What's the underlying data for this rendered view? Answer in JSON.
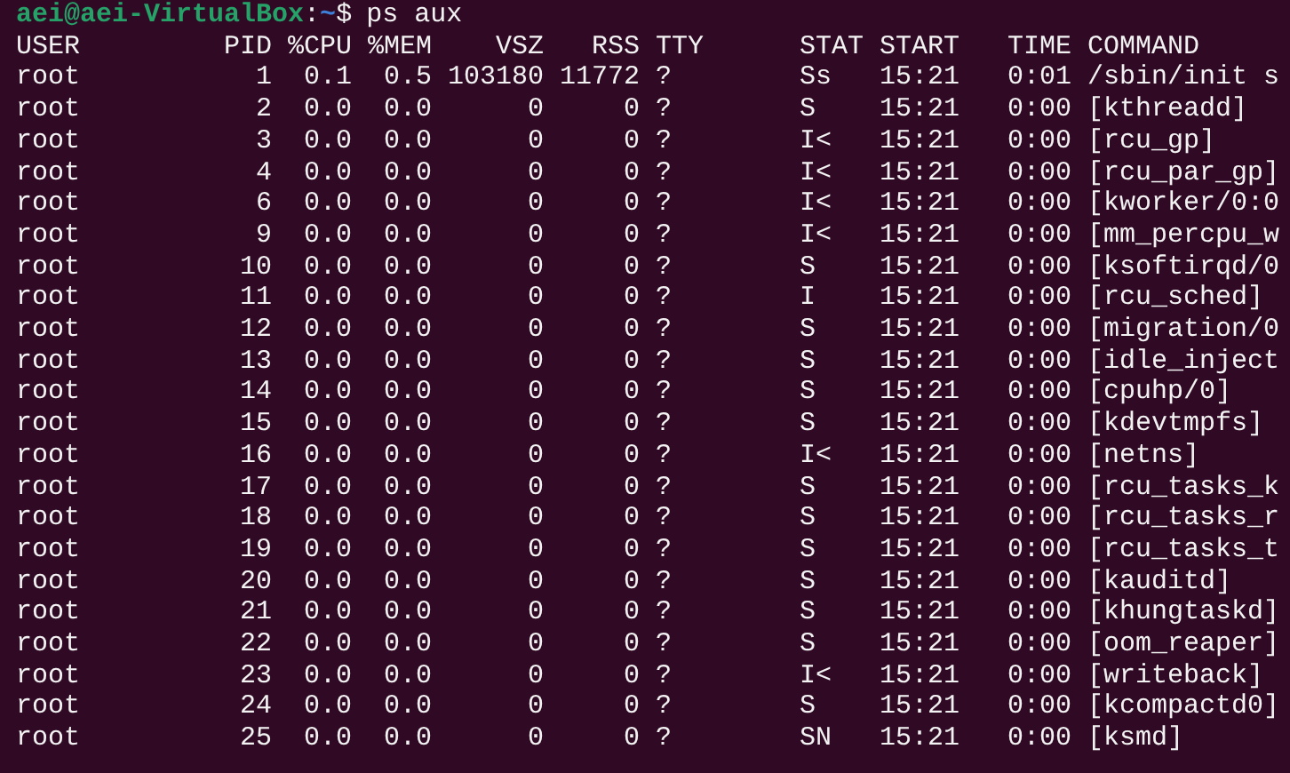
{
  "prompt": {
    "user_host": "aei@aei-VirtualBox",
    "separator": ":",
    "path": "~",
    "symbol": "$",
    "command": "ps aux"
  },
  "table": {
    "columns": [
      "USER",
      "PID",
      "%CPU",
      "%MEM",
      "VSZ",
      "RSS",
      "TTY",
      "STAT",
      "START",
      "TIME",
      "COMMAND"
    ],
    "rows": [
      [
        "root",
        "1",
        "0.1",
        "0.5",
        "103180",
        "11772",
        "?",
        "Ss",
        "15:21",
        "0:01",
        "/sbin/init s"
      ],
      [
        "root",
        "2",
        "0.0",
        "0.0",
        "0",
        "0",
        "?",
        "S",
        "15:21",
        "0:00",
        "[kthreadd]"
      ],
      [
        "root",
        "3",
        "0.0",
        "0.0",
        "0",
        "0",
        "?",
        "I<",
        "15:21",
        "0:00",
        "[rcu_gp]"
      ],
      [
        "root",
        "4",
        "0.0",
        "0.0",
        "0",
        "0",
        "?",
        "I<",
        "15:21",
        "0:00",
        "[rcu_par_gp]"
      ],
      [
        "root",
        "6",
        "0.0",
        "0.0",
        "0",
        "0",
        "?",
        "I<",
        "15:21",
        "0:00",
        "[kworker/0:0"
      ],
      [
        "root",
        "9",
        "0.0",
        "0.0",
        "0",
        "0",
        "?",
        "I<",
        "15:21",
        "0:00",
        "[mm_percpu_w"
      ],
      [
        "root",
        "10",
        "0.0",
        "0.0",
        "0",
        "0",
        "?",
        "S",
        "15:21",
        "0:00",
        "[ksoftirqd/0"
      ],
      [
        "root",
        "11",
        "0.0",
        "0.0",
        "0",
        "0",
        "?",
        "I",
        "15:21",
        "0:00",
        "[rcu_sched]"
      ],
      [
        "root",
        "12",
        "0.0",
        "0.0",
        "0",
        "0",
        "?",
        "S",
        "15:21",
        "0:00",
        "[migration/0"
      ],
      [
        "root",
        "13",
        "0.0",
        "0.0",
        "0",
        "0",
        "?",
        "S",
        "15:21",
        "0:00",
        "[idle_inject"
      ],
      [
        "root",
        "14",
        "0.0",
        "0.0",
        "0",
        "0",
        "?",
        "S",
        "15:21",
        "0:00",
        "[cpuhp/0]"
      ],
      [
        "root",
        "15",
        "0.0",
        "0.0",
        "0",
        "0",
        "?",
        "S",
        "15:21",
        "0:00",
        "[kdevtmpfs]"
      ],
      [
        "root",
        "16",
        "0.0",
        "0.0",
        "0",
        "0",
        "?",
        "I<",
        "15:21",
        "0:00",
        "[netns]"
      ],
      [
        "root",
        "17",
        "0.0",
        "0.0",
        "0",
        "0",
        "?",
        "S",
        "15:21",
        "0:00",
        "[rcu_tasks_k"
      ],
      [
        "root",
        "18",
        "0.0",
        "0.0",
        "0",
        "0",
        "?",
        "S",
        "15:21",
        "0:00",
        "[rcu_tasks_r"
      ],
      [
        "root",
        "19",
        "0.0",
        "0.0",
        "0",
        "0",
        "?",
        "S",
        "15:21",
        "0:00",
        "[rcu_tasks_t"
      ],
      [
        "root",
        "20",
        "0.0",
        "0.0",
        "0",
        "0",
        "?",
        "S",
        "15:21",
        "0:00",
        "[kauditd]"
      ],
      [
        "root",
        "21",
        "0.0",
        "0.0",
        "0",
        "0",
        "?",
        "S",
        "15:21",
        "0:00",
        "[khungtaskd]"
      ],
      [
        "root",
        "22",
        "0.0",
        "0.0",
        "0",
        "0",
        "?",
        "S",
        "15:21",
        "0:00",
        "[oom_reaper]"
      ],
      [
        "root",
        "23",
        "0.0",
        "0.0",
        "0",
        "0",
        "?",
        "I<",
        "15:21",
        "0:00",
        "[writeback]"
      ],
      [
        "root",
        "24",
        "0.0",
        "0.0",
        "0",
        "0",
        "?",
        "S",
        "15:21",
        "0:00",
        "[kcompactd0]"
      ],
      [
        "root",
        "25",
        "0.0",
        "0.0",
        "0",
        "0",
        "?",
        "SN",
        "15:21",
        "0:00",
        "[ksmd]"
      ]
    ]
  }
}
